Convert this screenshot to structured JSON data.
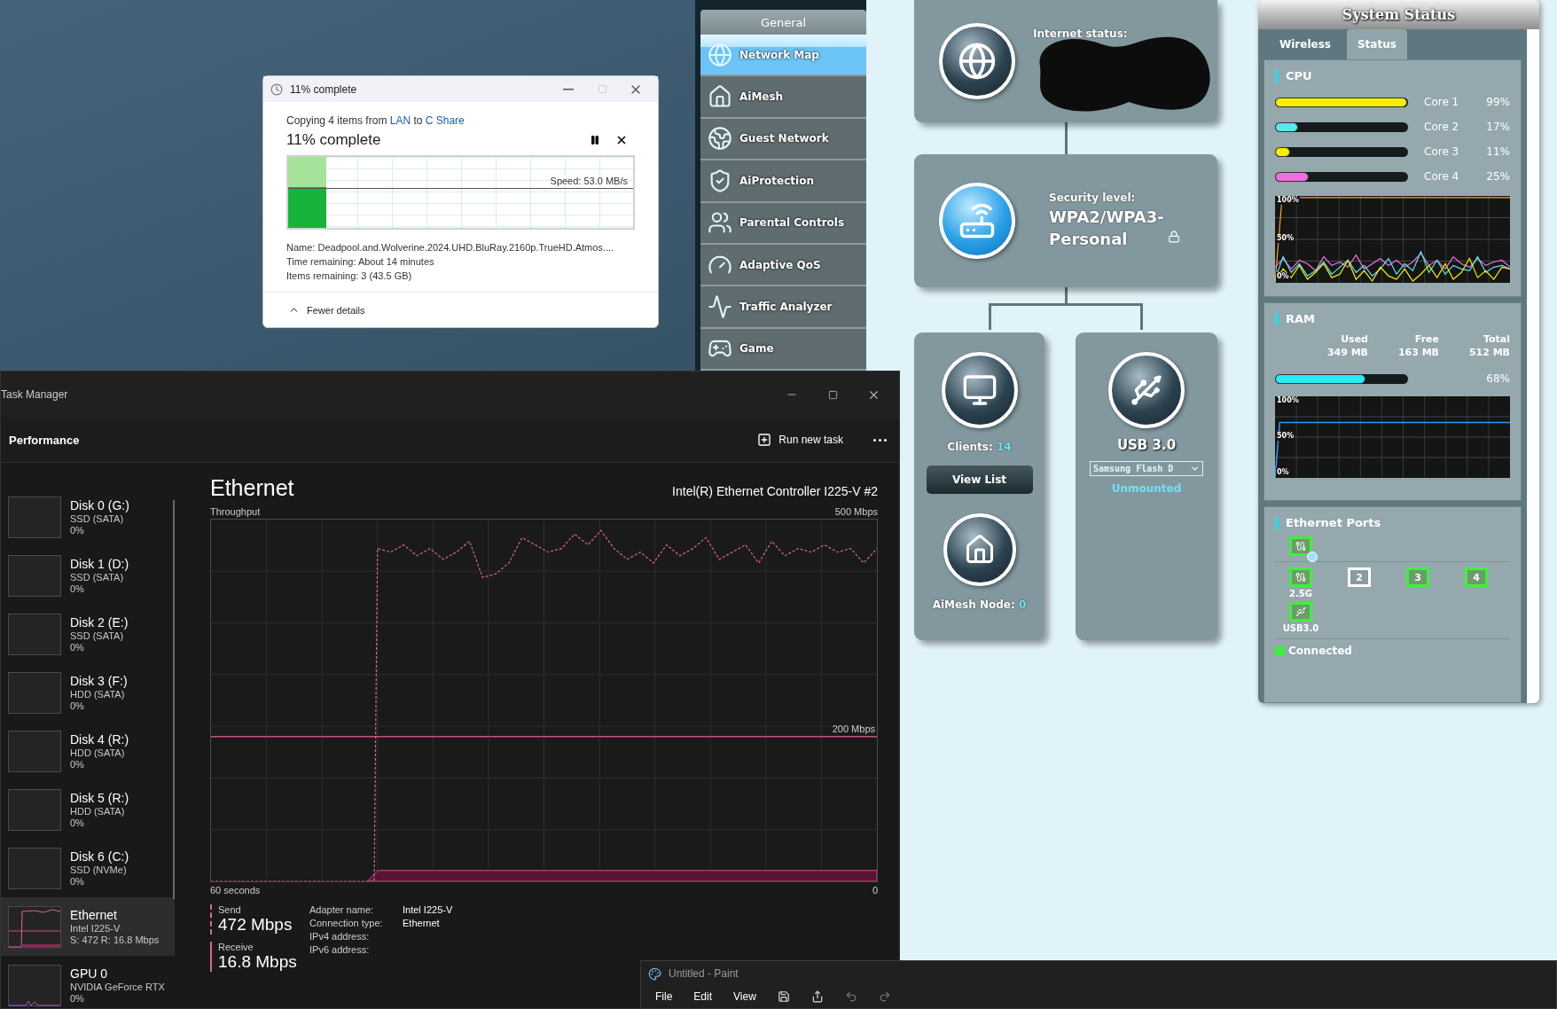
{
  "copy_dialog": {
    "title": "11% complete",
    "summary": {
      "prefix": "Copying 4 items from",
      "source": "LAN",
      "middle": "to",
      "destination": "C Share"
    },
    "heading": "11% complete",
    "level": 0.11,
    "speed": "Speed: 53.0 MB/s",
    "details": [
      "Name:  Deadpool.and.Wolverine.2024.UHD.BluRay.2160p.TrueHD.Atmos....",
      "Time remaining:  About 14 minutes",
      "Items remaining:  3 (43.5 GB)"
    ],
    "toggle": "Fewer details",
    "expanded": true
  },
  "router": {
    "sidebar": {
      "header": "General",
      "items": [
        {
          "label": "Network Map",
          "selected": true
        },
        {
          "label": "AiMesh",
          "selected": false
        },
        {
          "label": "Guest Network",
          "selected": false
        },
        {
          "label": "AiProtection",
          "selected": false
        },
        {
          "label": "Parental Controls",
          "selected": false
        },
        {
          "label": "Adaptive QoS",
          "selected": false
        },
        {
          "label": "Traffic Analyzer",
          "selected": false
        },
        {
          "label": "Game",
          "selected": false
        }
      ]
    },
    "network_map": {
      "internet": {
        "label": "Internet status:"
      },
      "security": {
        "label": "Security level:",
        "value": "WPA2/WPA3-Personal"
      },
      "clients": {
        "label": "Clients:",
        "count": "14",
        "button": "View List"
      },
      "aimesh": {
        "label": "AiMesh Node:",
        "count": "0"
      },
      "usb": {
        "title": "USB 3.0",
        "device": "Samsung Flash D",
        "status": "Unmounted"
      }
    },
    "system_status": {
      "title": "System Status",
      "tabs": [
        {
          "label": "Wireless",
          "selected": false
        },
        {
          "label": "Status",
          "selected": true
        }
      ],
      "cpu": {
        "title": "CPU",
        "cores": [
          {
            "name": "Core 1",
            "reading": "99%",
            "level": 0.99,
            "color": "#f5ee00"
          },
          {
            "name": "Core 2",
            "reading": "17%",
            "level": 0.17,
            "color": "#5ce6f0"
          },
          {
            "name": "Core 3",
            "reading": "11%",
            "level": 0.11,
            "color": "#f5ee00"
          },
          {
            "name": "Core 4",
            "reading": "25%",
            "level": 0.25,
            "color": "#f06ee0"
          }
        ],
        "graph_ticks": [
          "100%",
          "50%",
          "0%"
        ]
      },
      "ram": {
        "title": "RAM",
        "columns": [
          {
            "label": "Used",
            "value": "349 MB"
          },
          {
            "label": "Free",
            "value": "163 MB"
          },
          {
            "label": "Total",
            "value": "512 MB"
          }
        ],
        "level": 0.68,
        "reading": "68%",
        "graph_ticks": [
          "100%",
          "50%",
          "0%"
        ]
      },
      "ethernet": {
        "title": "Ethernet Ports",
        "wan": {
          "connected": true
        },
        "lan_ports": [
          {
            "kind": "icon",
            "caption": "2.5G",
            "connected": true
          },
          {
            "kind": "number",
            "number": "2",
            "connected": false
          },
          {
            "kind": "number",
            "number": "3",
            "connected": true
          },
          {
            "kind": "number",
            "number": "4",
            "connected": true
          }
        ],
        "usb_port": {
          "caption": "USB3.0",
          "connected": true
        },
        "legend": "Connected"
      }
    }
  },
  "task_manager": {
    "title": "Task Manager",
    "header": "Performance",
    "run_task": "Run new task",
    "devices": [
      {
        "kind": "disk",
        "name": "Disk 0 (G:)",
        "lines": [
          "SSD (SATA)",
          "0%"
        ],
        "selected": false
      },
      {
        "kind": "disk",
        "name": "Disk 1 (D:)",
        "lines": [
          "SSD (SATA)",
          "0%"
        ],
        "selected": false
      },
      {
        "kind": "disk",
        "name": "Disk 2 (E:)",
        "lines": [
          "SSD (SATA)",
          "0%"
        ],
        "selected": false
      },
      {
        "kind": "disk",
        "name": "Disk 3 (F:)",
        "lines": [
          "HDD (SATA)",
          "0%"
        ],
        "selected": false
      },
      {
        "kind": "disk",
        "name": "Disk 4 (R:)",
        "lines": [
          "HDD (SATA)",
          "0%"
        ],
        "selected": false
      },
      {
        "kind": "disk",
        "name": "Disk 5 (R:)",
        "lines": [
          "HDD (SATA)",
          "0%"
        ],
        "selected": false
      },
      {
        "kind": "disk",
        "name": "Disk 6 (C:)",
        "lines": [
          "SSD (NVMe)",
          "0%"
        ],
        "selected": false
      },
      {
        "kind": "ethernet",
        "name": "Ethernet",
        "lines": [
          "Intel I225-V",
          "S: 472 R: 16.8 Mbps"
        ],
        "selected": true
      },
      {
        "kind": "gpu",
        "name": "GPU 0",
        "lines": [
          "NVIDIA GeForce RTX",
          "0%"
        ],
        "selected": false
      }
    ],
    "main": {
      "title": "Ethernet",
      "adapter": "Intel(R) Ethernet Controller I225-V #2",
      "chart_label": "Throughput",
      "max_label": "500 Mbps",
      "ref_label": "200 Mbps",
      "time_label": "60 seconds",
      "zero_label": "0",
      "send": {
        "label": "Send",
        "value": "472 Mbps"
      },
      "receive": {
        "label": "Receive",
        "value": "16.8 Mbps"
      },
      "properties": [
        {
          "label": "Adapter name:",
          "value": "Intel I225-V"
        },
        {
          "label": "Connection type:",
          "value": "Ethernet"
        },
        {
          "label": "IPv4 address:"
        },
        {
          "label": "IPv6 address:"
        }
      ]
    }
  },
  "paint": {
    "title": "Untitled - Paint",
    "menu": [
      "File",
      "Edit",
      "View"
    ]
  }
}
